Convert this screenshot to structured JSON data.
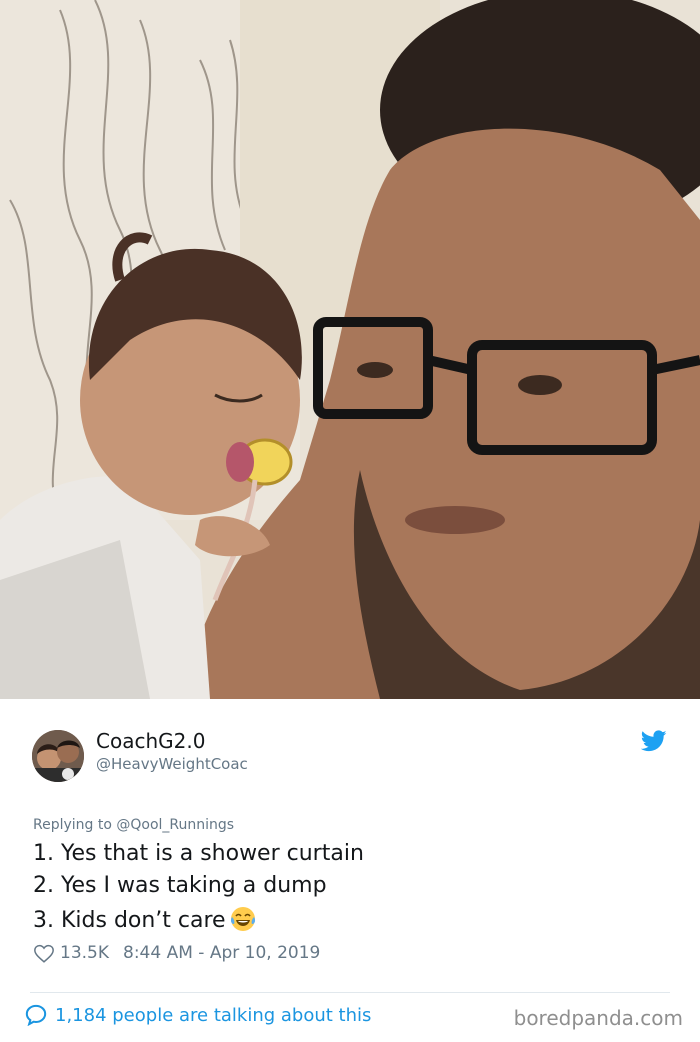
{
  "photo": {
    "description_icon": "photo-image"
  },
  "tweet": {
    "display_name": "CoachG2.0",
    "handle": "@HeavyWeightCoac",
    "replying_to": "Replying to @Qool_Runnings",
    "lines": [
      "1. Yes that is a shower curtain",
      "2. Yes I was taking a dump",
      "3. Kids don’t care"
    ],
    "emoji_icon": "tears-of-joy-emoji-icon",
    "likes": "13.5K",
    "timestamp": "8:44 AM - Apr 10, 2019",
    "talking": "1,184 people are talking about this"
  },
  "footer": {
    "brand": "boredpanda.com"
  },
  "colors": {
    "twitter_blue": "#1da1f2",
    "link_blue": "#1b95e0",
    "muted": "#657786"
  }
}
